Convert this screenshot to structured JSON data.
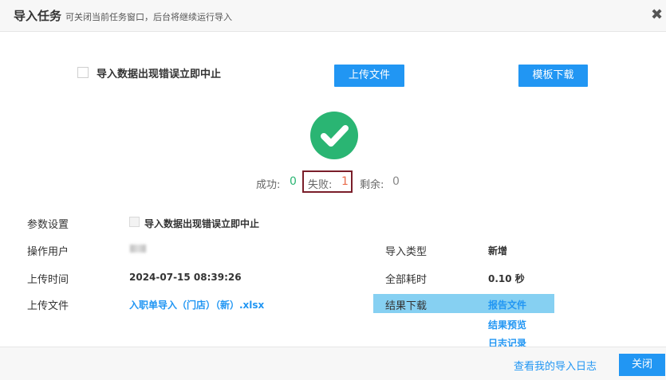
{
  "dialog": {
    "title": "导入任务",
    "subtitle": "可关闭当前任务窗口，后台将继续运行导入",
    "close_glyph": "✖"
  },
  "options": {
    "stop_on_error_label": "导入数据出现错误立即中止",
    "stop_on_error_checked": false
  },
  "buttons": {
    "upload": "上传文件",
    "template_download": "模板下载"
  },
  "status": {
    "icon": "success-check-icon",
    "color": "#2ab573",
    "success_label": "成功:",
    "success_value": "0",
    "fail_label": "失败:",
    "fail_value": "1",
    "remaining_label": "剩余:",
    "remaining_value": "0"
  },
  "details": {
    "param_label": "参数设置",
    "param_value": "导入数据出现错误立即中止",
    "operator_label": "操作用户",
    "import_type_label": "导入类型",
    "import_type_value": "新增",
    "upload_time_label": "上传时间",
    "upload_time_value": "2024-07-15 08:39:26",
    "duration_label": "全部耗时",
    "duration_value": "0.10 秒",
    "upload_file_label": "上传文件",
    "upload_file_value": "入职单导入（门店）（新）.xlsx",
    "result_download_label": "结果下载",
    "result_links": [
      "报告文件",
      "结果预览",
      "日志记录"
    ]
  },
  "footer": {
    "my_import_log": "查看我的导入日志",
    "close": "关闭"
  },
  "colors": {
    "primary": "#2196f3",
    "success": "#2ab573",
    "fail": "#e96c4c",
    "highlight": "#86d0f2"
  }
}
